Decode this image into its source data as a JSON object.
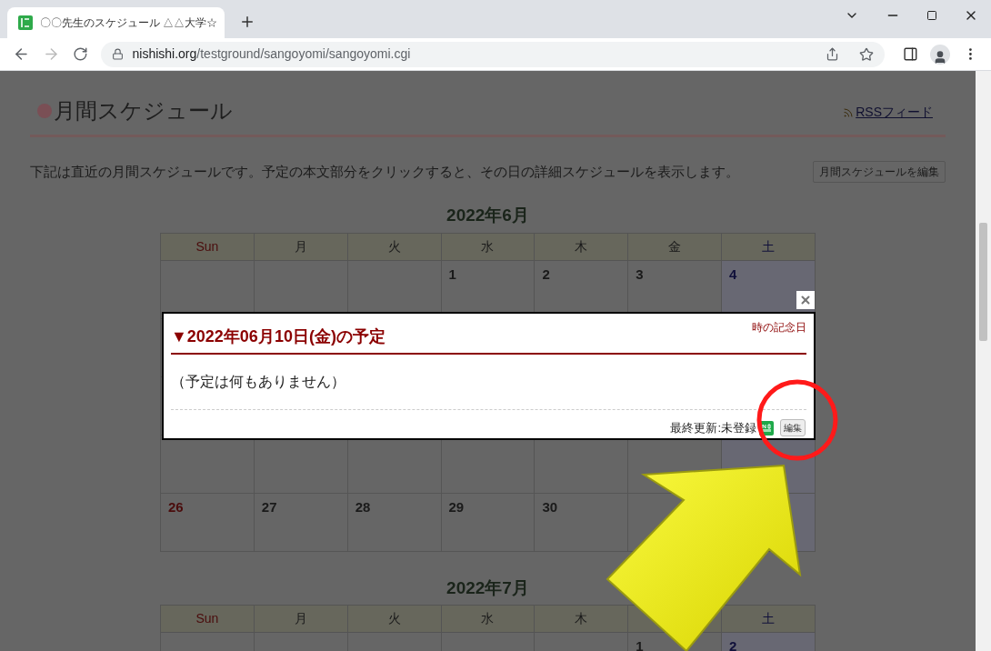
{
  "browser": {
    "tab": {
      "title": "〇〇先生のスケジュール △△大学☆",
      "selected": true
    },
    "forward_disabled": true,
    "address": {
      "host": "nishishi.org",
      "path": "/testground/sangoyomi/sangoyomi.cgi"
    }
  },
  "page": {
    "title": "月間スケジュール",
    "rss_link": "RSSフィード",
    "intro": "下記は直近の月間スケジュールです。予定の本文部分をクリックすると、その日の詳細スケジュールを表示します。",
    "edit_month_button": "月間スケジュールを編集",
    "months": [
      {
        "title": "2022年6月",
        "weekdays": [
          {
            "kind": "label",
            "label": "Sun"
          },
          {
            "kind": "label",
            "label": "月"
          },
          {
            "kind": "label",
            "label": "火"
          },
          {
            "kind": "label",
            "label": "水"
          },
          {
            "kind": "label",
            "label": "木"
          },
          {
            "kind": "label",
            "label": "金"
          },
          {
            "kind": "label",
            "label": "土"
          }
        ],
        "weeks": [
          [
            {
              "kind": "blank"
            },
            {
              "kind": "blank"
            },
            {
              "kind": "blank"
            },
            {
              "kind": "day",
              "day": "1"
            },
            {
              "kind": "day",
              "day": "2"
            },
            {
              "kind": "day",
              "day": "3"
            },
            {
              "kind": "day",
              "day": "4"
            }
          ],
          [
            {
              "kind": "covered"
            },
            {
              "kind": "covered"
            },
            {
              "kind": "covered"
            },
            {
              "kind": "covered"
            },
            {
              "kind": "covered"
            },
            {
              "kind": "covered"
            },
            {
              "kind": "covered"
            }
          ],
          [
            {
              "kind": "covered"
            },
            {
              "kind": "covered"
            },
            {
              "kind": "covered"
            },
            {
              "kind": "covered"
            },
            {
              "kind": "covered"
            },
            {
              "kind": "covered"
            },
            {
              "kind": "covered"
            }
          ],
          [
            {
              "kind": "blank"
            },
            {
              "kind": "blank"
            },
            {
              "kind": "blank"
            },
            {
              "kind": "blank"
            },
            {
              "kind": "blank"
            },
            {
              "kind": "blank"
            },
            {
              "kind": "blank"
            }
          ],
          [
            {
              "kind": "day",
              "day": "26"
            },
            {
              "kind": "day",
              "day": "27"
            },
            {
              "kind": "day",
              "day": "28"
            },
            {
              "kind": "day",
              "day": "29"
            },
            {
              "kind": "day",
              "day": "30"
            },
            {
              "kind": "blank"
            },
            {
              "kind": "blank"
            }
          ]
        ]
      },
      {
        "title": "2022年7月",
        "weekdays": [
          {
            "kind": "label",
            "label": "Sun"
          },
          {
            "kind": "label",
            "label": "月"
          },
          {
            "kind": "label",
            "label": "火"
          },
          {
            "kind": "label",
            "label": "水"
          },
          {
            "kind": "label",
            "label": "木"
          },
          {
            "kind": "covered"
          },
          {
            "kind": "label",
            "label": "土"
          }
        ],
        "weeks": [
          [
            {
              "kind": "blank"
            },
            {
              "kind": "blank"
            },
            {
              "kind": "blank"
            },
            {
              "kind": "blank"
            },
            {
              "kind": "blank"
            },
            {
              "kind": "day",
              "day": "1"
            },
            {
              "kind": "day",
              "day": "2"
            }
          ]
        ]
      }
    ]
  },
  "modal": {
    "heading": "▼2022年06月10日(金)の予定",
    "anniversary": "時の記念日",
    "message": "（予定は何もありません）",
    "updated": "最終更新:未登録",
    "edit_button": "編集"
  }
}
